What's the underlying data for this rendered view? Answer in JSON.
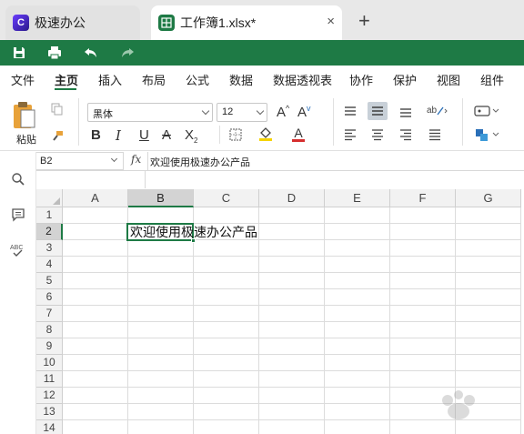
{
  "tabs": [
    {
      "label": "极速办公",
      "icon": "app-logo-icon"
    },
    {
      "label": "工作簿1.xlsx*",
      "icon": "spreadsheet-icon",
      "close": "×"
    }
  ],
  "new_tab": "+",
  "quick_access": [
    "save-icon",
    "print-icon",
    "undo-icon",
    "redo-icon"
  ],
  "menu": {
    "items": [
      "文件",
      "主页",
      "插入",
      "布局",
      "公式",
      "数据",
      "数据透视表",
      "协作",
      "保护",
      "视图",
      "组件"
    ],
    "active": "主页"
  },
  "ribbon": {
    "paste_label": "粘贴",
    "font_name": "黑体",
    "font_size": "12",
    "bold": "B",
    "italic": "I",
    "underline": "U",
    "strike": "A",
    "subscript": "X",
    "subscript_small": "2",
    "font_color_letter": "A",
    "grow_font": "A",
    "shrink_font": "A"
  },
  "formula_bar": {
    "name_box": "B2",
    "fx": "fx",
    "content": "欢迎使用极速办公产品"
  },
  "grid": {
    "columns": [
      "A",
      "B",
      "C",
      "D",
      "E",
      "F",
      "G"
    ],
    "rows": [
      "1",
      "2",
      "3",
      "4",
      "5",
      "6",
      "7",
      "8",
      "9",
      "10",
      "11",
      "12",
      "13",
      "14"
    ],
    "selected_column": "B",
    "selected_row": "2",
    "cells": [
      {
        "ref": "B2",
        "value": "欢迎使用极速办公产品"
      }
    ]
  },
  "colors": {
    "brand_green": "#1e7a45",
    "highlight_yellow": "#f5d300",
    "font_red": "#d62f2f"
  }
}
